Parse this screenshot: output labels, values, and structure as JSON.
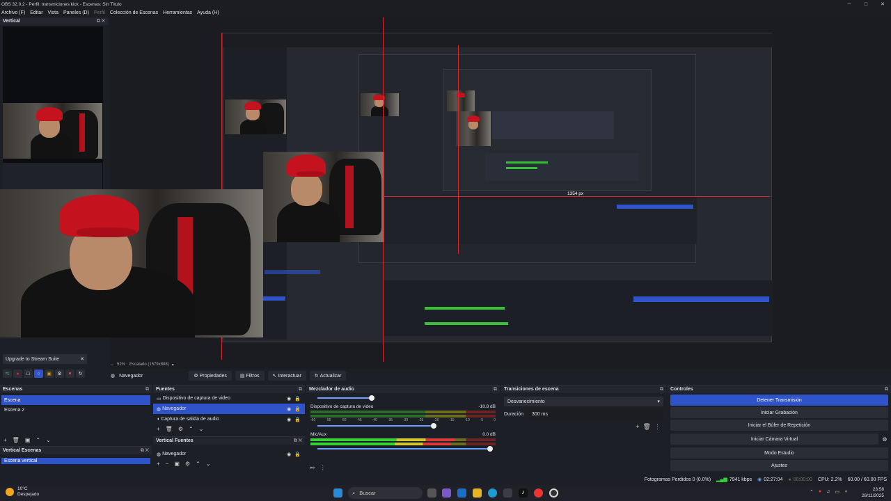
{
  "window": {
    "title": "OBS 32.0.2 - Perfil: transmiciones kick - Escenas: Sin Título"
  },
  "menu": [
    "Archivo (F)",
    "Editar",
    "Vista",
    "Paneles (D)",
    "Perfil",
    "Colección de Escenas",
    "Herramientas",
    "Ayuda (H)"
  ],
  "vertical": {
    "title": "Vertical"
  },
  "upgrade": {
    "label": "Upgrade to Stream Suite"
  },
  "preview": {
    "measure_label": "1354 px",
    "zoom": "52%",
    "scale": "Escalado (1579x888)"
  },
  "context": {
    "source": "Navegador",
    "properties": "Propiedades",
    "filters": "Filtros",
    "interact": "Interactuar",
    "refresh": "Actualizar"
  },
  "scenes": {
    "title": "Escenas",
    "items": [
      "Escena",
      "Escena 2"
    ]
  },
  "vertical_scenes": {
    "title": "Vertical Escenas",
    "items": [
      "Escena vertical"
    ]
  },
  "sources": {
    "title": "Fuentes",
    "items": [
      "Dispositivo de captura de video",
      "Navegador",
      "Captura de salida de audio"
    ]
  },
  "vertical_sources": {
    "title": "Vertical Fuentes",
    "items": [
      "Navegador"
    ]
  },
  "mixer": {
    "title": "Mezclador de audio",
    "ticks": [
      "-60",
      "-55",
      "-50",
      "-45",
      "-40",
      "-35",
      "-30",
      "-25",
      "-20",
      "-15",
      "-10",
      "-5",
      "0"
    ],
    "channels": [
      {
        "name": "Dispositivo de captura de video",
        "db": "-10.8 dB"
      },
      {
        "name": "Mic/Aux",
        "db": "0.0 dB"
      }
    ]
  },
  "transitions": {
    "title": "Transiciones de escena",
    "selected": "Desvanecimiento",
    "duration_label": "Duración",
    "duration_value": "300 ms"
  },
  "controls": {
    "title": "Controles",
    "buttons": [
      "Detener Transmisión",
      "Iniciar Grabación",
      "Iniciar el Búfer de Repetición",
      "Iniciar Cámara Virtual",
      "Modo Estudio",
      "Ajustes"
    ]
  },
  "status": {
    "dropped": "Fotogramas Perdidos 0 (0.0%)",
    "kbps": "7941 kbps",
    "live_time": "02:27:04",
    "rec_time": "00:00:00",
    "cpu": "CPU: 2.2%",
    "fps": "60.00 / 60.00 FPS"
  },
  "taskbar": {
    "weather_temp": "10°C",
    "weather_desc": "Despejado",
    "search_label": "Buscar",
    "time": "23:58",
    "date": "26/11/2025"
  },
  "colors": {
    "accent": "#2f53c9",
    "guide": "#d9252b",
    "meter_green": "#39cf39",
    "hat": "#c4121f"
  }
}
